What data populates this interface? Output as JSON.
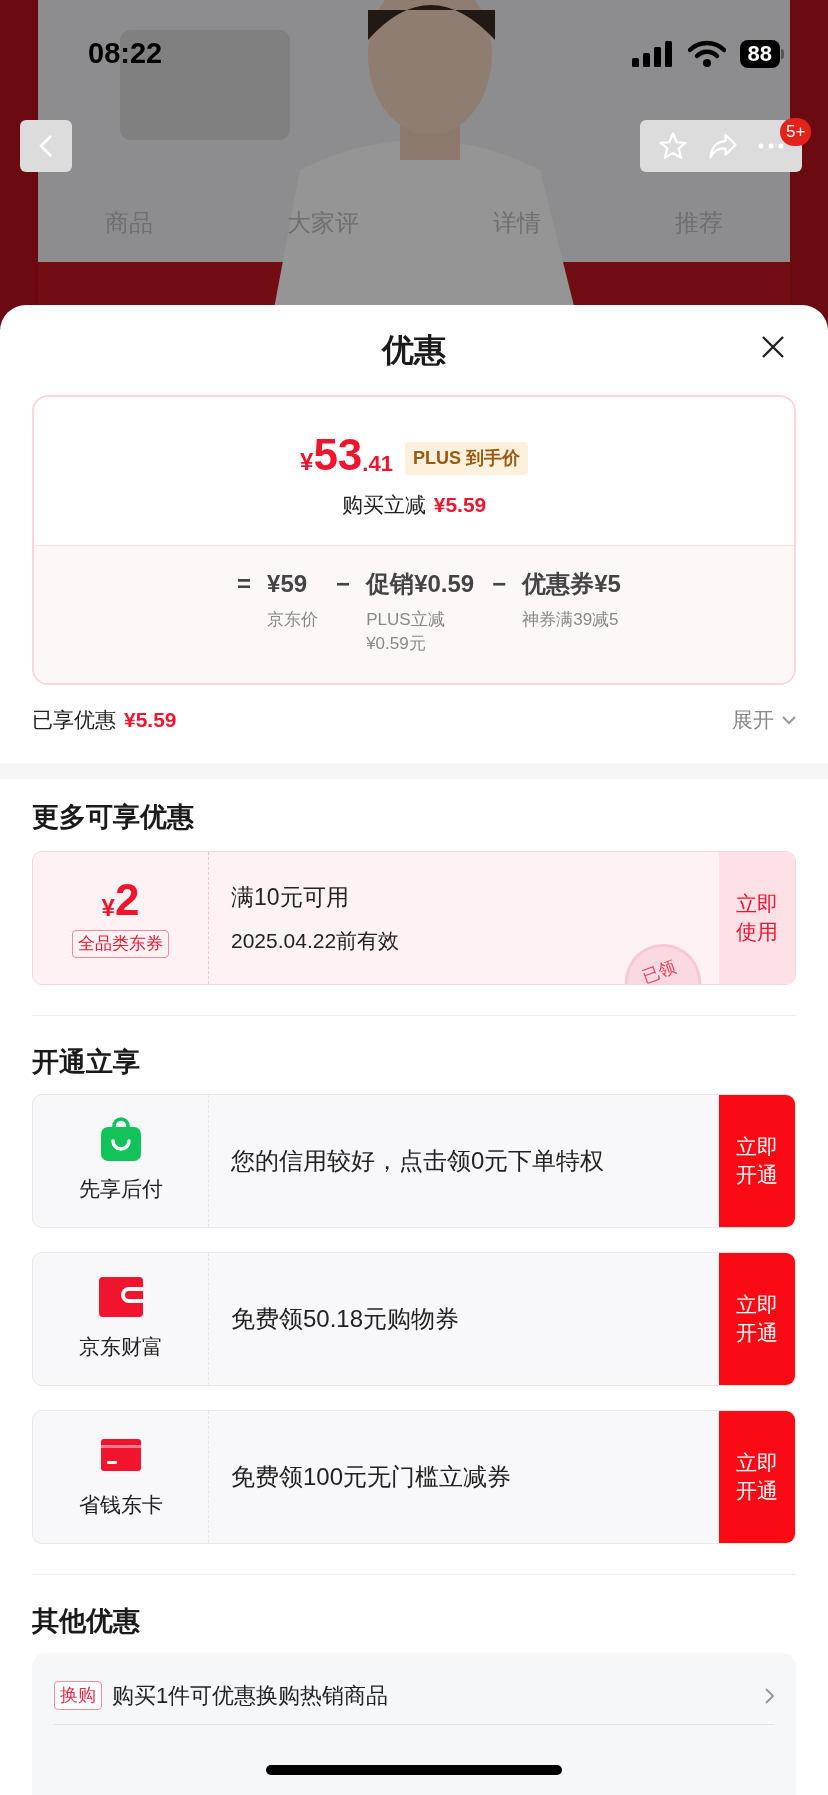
{
  "status_bar": {
    "time": "08:22",
    "battery": "88"
  },
  "product_header": {
    "badge": "5+",
    "tabs": [
      {
        "label": "商品"
      },
      {
        "label": "大家评"
      },
      {
        "label": "详情"
      },
      {
        "label": "推荐"
      }
    ]
  },
  "sheet": {
    "title": "优惠",
    "price": {
      "symbol": "¥",
      "integer": "53",
      "decimal": ".41",
      "tag": "PLUS 到手价",
      "reduce_label": "购买立减",
      "reduce_value": "¥5.59"
    },
    "breakdown": [
      {
        "operator": "=",
        "amount": "¥59",
        "note_lines": [
          "京东价"
        ]
      },
      {
        "operator": "−",
        "amount": "促销¥0.59",
        "note_lines": [
          "PLUS立减",
          "¥0.59元"
        ]
      },
      {
        "operator": "−",
        "amount": "优惠券¥5",
        "note_lines": [
          "神券满39减5"
        ]
      }
    ],
    "enjoyed": {
      "label": "已享优惠",
      "value": "¥5.59",
      "expand": "展开"
    },
    "more_section": {
      "title": "更多可享优惠",
      "coupons": [
        {
          "symbol": "¥",
          "amount": "2",
          "tag": "全品类东券",
          "condition": "满10元可用",
          "validity": "2025.04.22前有效",
          "stamp": "已领",
          "action": "立即使用"
        }
      ]
    },
    "open_section": {
      "title": "开通立享",
      "items": [
        {
          "kind": "bag",
          "name": "先享后付",
          "text": "您的信用较好，点击领0元下单特权",
          "action": "立即开通"
        },
        {
          "kind": "wallet",
          "name": "京东财富",
          "text": "免费领50.18元购物券",
          "action": "立即开通"
        },
        {
          "kind": "card",
          "name": "省钱东卡",
          "text": "免费领100元无门槛立减券",
          "action": "立即开通"
        }
      ]
    },
    "other_section": {
      "title": "其他优惠",
      "rows": [
        {
          "tag": "换购",
          "text": "购买1件可优惠换购热销商品"
        }
      ]
    }
  }
}
